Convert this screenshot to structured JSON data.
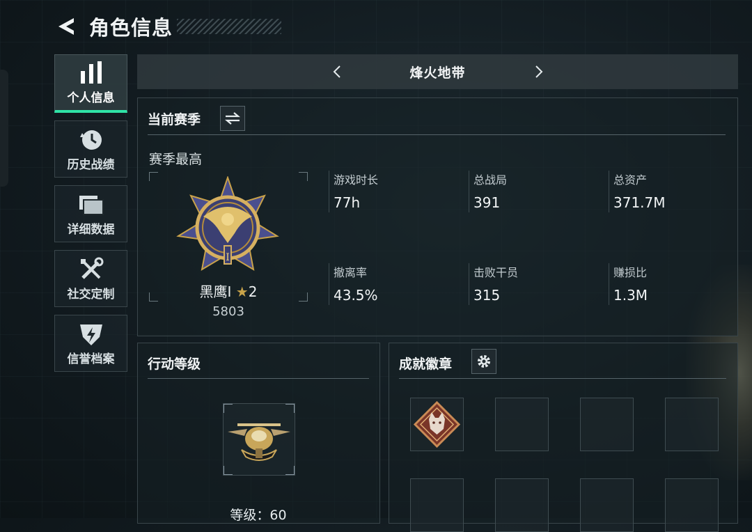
{
  "header": {
    "title": "角色信息",
    "back_icon": "back-arrow-icon"
  },
  "nav": {
    "items": [
      {
        "label": "个人信息",
        "icon": "bar-chart-icon",
        "active": true
      },
      {
        "label": "历史战绩",
        "icon": "history-clock-icon",
        "active": false
      },
      {
        "label": "详细数据",
        "icon": "stacked-folders-icon",
        "active": false
      },
      {
        "label": "社交定制",
        "icon": "wrench-screwdriver-icon",
        "active": false
      },
      {
        "label": "信誉档案",
        "icon": "emblem-lightning-icon",
        "active": false
      }
    ]
  },
  "season_selector": {
    "current": "烽火地带"
  },
  "current_season": {
    "title": "当前赛季",
    "season_high_label": "赛季最高",
    "rank": {
      "name": "黑鹰I",
      "stars": "2",
      "score": "5803"
    },
    "stats": [
      {
        "label": "游戏时长",
        "value": "77h"
      },
      {
        "label": "总战局",
        "value": "391"
      },
      {
        "label": "总资产",
        "value": "371.7M"
      },
      {
        "label": "撤离率",
        "value": "43.5%"
      },
      {
        "label": "击败干员",
        "value": "315"
      },
      {
        "label": "赚损比",
        "value": "1.3M"
      }
    ]
  },
  "action_level": {
    "title": "行动等级",
    "level_text": "等级：60"
  },
  "achievements": {
    "title": "成就徽章",
    "settings_icon": "gear-icon"
  },
  "colors": {
    "accent": "#2fe3a6",
    "panel_border": "#3a464b",
    "background": "#121b20"
  }
}
